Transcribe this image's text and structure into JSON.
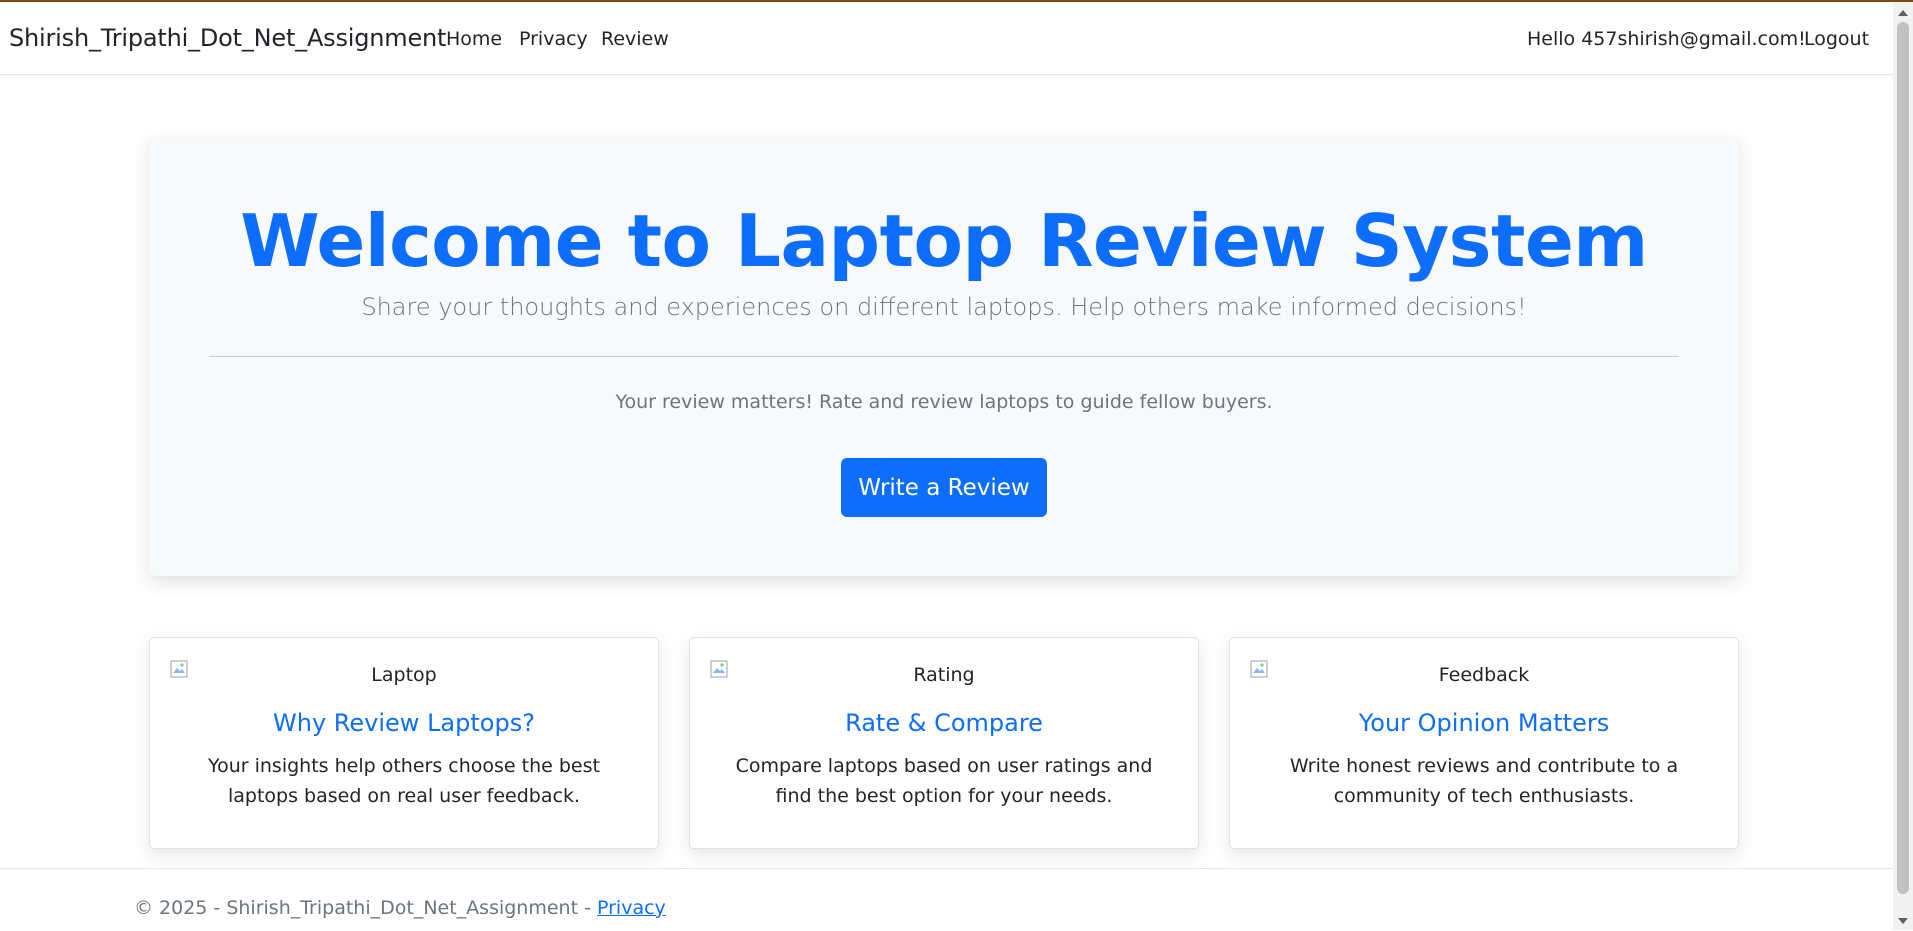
{
  "nav": {
    "brand": "Shirish_Tripathi_Dot_Net_Assignment",
    "links": [
      "Home",
      "Privacy",
      "Review"
    ],
    "greeting": "Hello 457shirish@gmail.com!",
    "logout": "Logout"
  },
  "hero": {
    "title": "Welcome to Laptop Review System",
    "subtitle": "Share your thoughts and experiences on different laptops. Help others make informed decisions!",
    "note": "Your review matters! Rate and review laptops to guide fellow buyers.",
    "cta": "Write a Review"
  },
  "cards": [
    {
      "img_alt": "Laptop",
      "title": "Why Review Laptops?",
      "text": "Your insights help others choose the best laptops based on real user feedback."
    },
    {
      "img_alt": "Rating",
      "title": "Rate & Compare",
      "text": "Compare laptops based on user ratings and find the best option for your needs."
    },
    {
      "img_alt": "Feedback",
      "title": "Your Opinion Matters",
      "text": "Write honest reviews and contribute to a community of tech enthusiasts."
    }
  ],
  "footer": {
    "copyright": "© 2025 - Shirish_Tripathi_Dot_Net_Assignment - ",
    "privacy_link": "Privacy"
  },
  "colors": {
    "primary": "#0d6efd",
    "muted": "#6c757d",
    "hero_bg": "#f8f9fa"
  }
}
